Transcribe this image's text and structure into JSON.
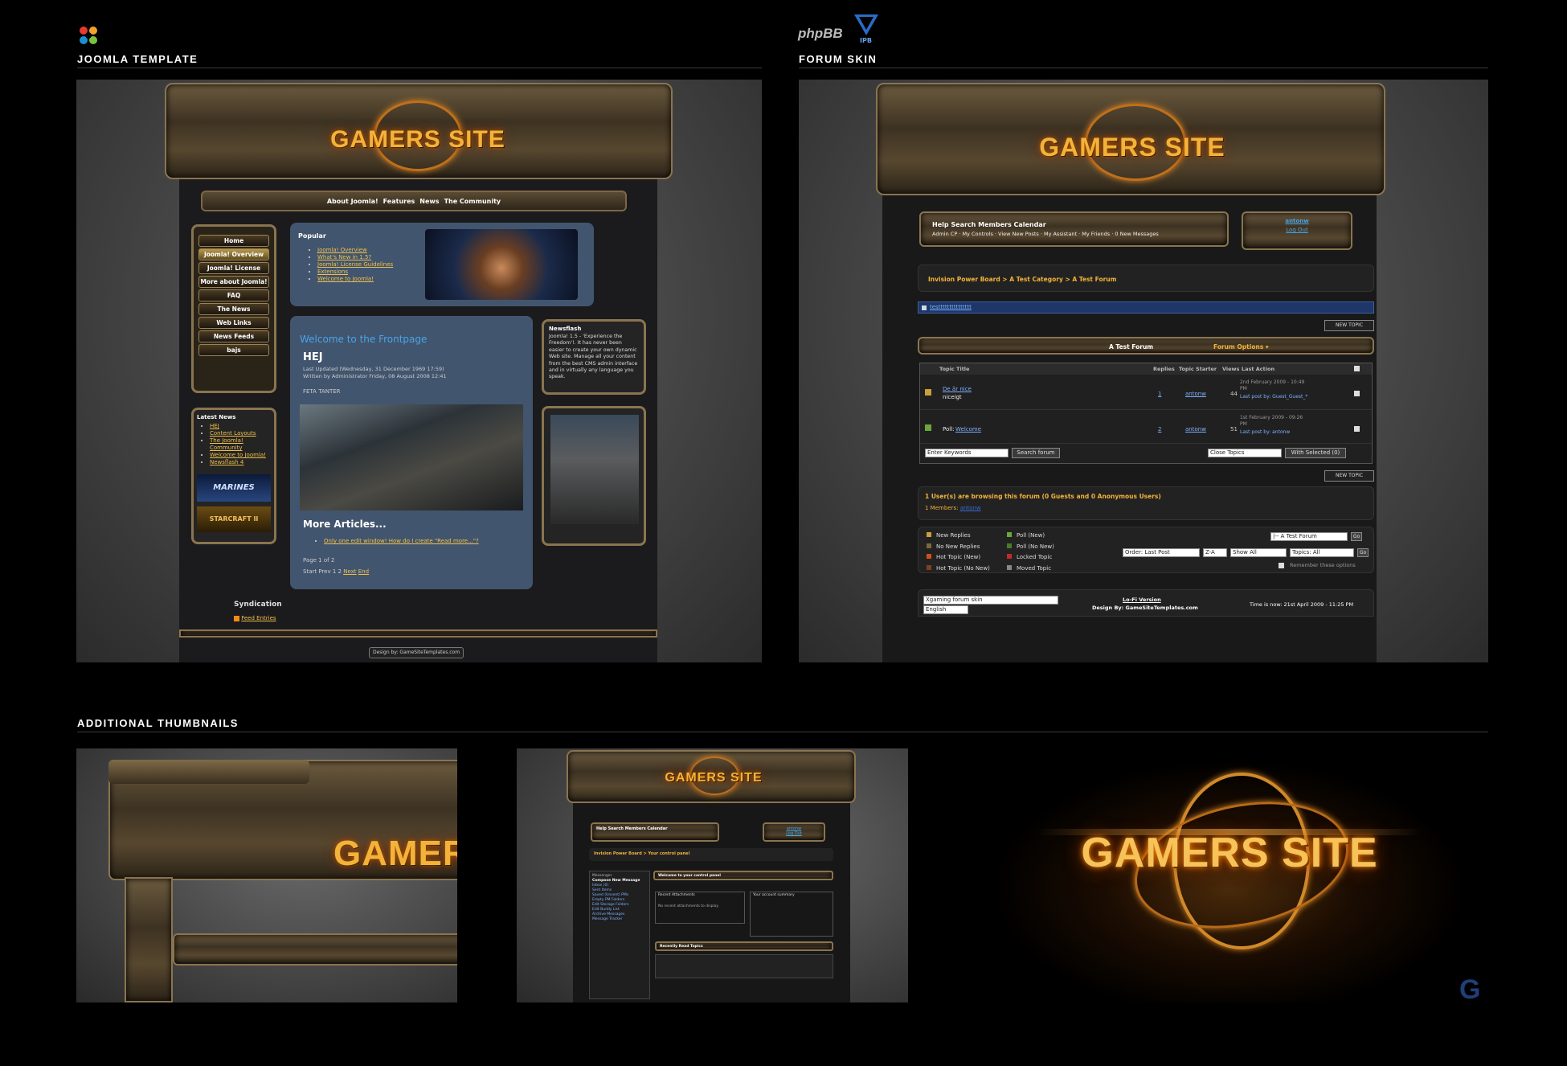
{
  "sections": {
    "joomla": "JOOMLA TEMPLATE",
    "forum": "FORUM SKIN",
    "additional": "ADDITIONAL THUMBNAILS"
  },
  "brand": {
    "logo_text": "GAMERS SITE",
    "phpbb_text": "phpBB",
    "ipb_text": "IPB",
    "accent": "#f3b33a"
  },
  "joomla": {
    "nav": [
      "About Joomla!",
      "Features",
      "News",
      "The Community"
    ],
    "menu": [
      "Home",
      "Joomla! Overview",
      "Joomla! License",
      "More about Joomla!",
      "FAQ",
      "The News",
      "Web Links",
      "News Feeds",
      "bajs"
    ],
    "popular": {
      "title": "Popular",
      "links": [
        "Joomla! Overview",
        "What's New in 1.5?",
        "Joomla! License Guidelines",
        "Extensions",
        "Welcome to Joomla!"
      ]
    },
    "latest_news": {
      "title": "Latest News",
      "links": [
        "HEJ",
        "Content Layouts",
        "The Joomla! Community",
        "Welcome to Joomla!",
        "Newsflash 4"
      ]
    },
    "banners": [
      "MARINES",
      "STARCRAFT II"
    ],
    "frontpage": {
      "heading": "Welcome to the Frontpage",
      "article_title": "HEJ",
      "meta": "Last Updated (Wednesday, 31 December 1969 17:59) Written by Administrator Friday, 08 August 2008 12:41",
      "body": "FETA TANTER",
      "more_heading": "More Articles...",
      "more_link": "Only one edit window! How do I create \"Read more...\"?",
      "page_info": "Page 1 of 2",
      "pager_prefix": "Start Prev 1 2",
      "pager_next": "Next",
      "pager_end": "End"
    },
    "newsflash": {
      "title": "Newsflash",
      "body": "Joomla! 1.5 - 'Experience the Freedom'!. It has never been easier to create your own dynamic Web site. Manage all your content from the best CMS admin interface and in virtually any language you speak."
    },
    "syndication": {
      "title": "Syndication",
      "link": "Feed Entries"
    },
    "footer": "Design by: GameSiteTemplates.com"
  },
  "forum": {
    "top_nav": "Help  Search  Members  Calendar",
    "sub_nav": "Admin CP  ·  My Controls  ·  View New Posts  ·  My Assistant  ·  My Friends  ·  0 New Messages",
    "user": "antonw",
    "logout": "Log Out",
    "breadcrumb": "Invision Power Board > A Test Category > A Test Forum",
    "announcement": "testtttttttttttttt",
    "new_topic": "NEW TOPIC",
    "forum_title": "A Test Forum",
    "forum_options": "Forum Options ▾",
    "columns": [
      "Topic Title",
      "Replies",
      "Topic Starter",
      "Views",
      "Last Action"
    ],
    "topics": [
      {
        "title": "De är nice",
        "desc": "niceigt",
        "replies": "1",
        "starter": "antonw",
        "views": "44",
        "last_date": "2nd February 2009 - 10:49 PM",
        "last_by": "Last post by: Guest_Guest_*"
      },
      {
        "prefix": "Poll:",
        "title": "Welcome",
        "desc": "",
        "replies": "2",
        "starter": "antonw",
        "views": "51",
        "last_date": "1st February 2009 - 09:26 PM",
        "last_by": "Last post by: antonw"
      }
    ],
    "search_placeholder": "Enter Keywords",
    "search_button": "Search forum",
    "close_topics": "Close Topics",
    "with_selected": "With Selected (0)",
    "browsing": "1 User(s) are browsing this forum (0 Guests and 0 Anonymous Users)",
    "members_label": "1 Members:",
    "members_name": "antonw",
    "legend_left": [
      "New Replies",
      "No New Replies",
      "Hot Topic (New)",
      "Hot Topic (No New)"
    ],
    "legend_right": [
      "Poll (New)",
      "Poll (No New)",
      "Locked Topic",
      "Moved Topic"
    ],
    "jump": "|-- A Test Forum",
    "go": "Go",
    "order": "Order: Last Post",
    "za": "Z-A",
    "show": "Show All",
    "topics_all": "Topics: All",
    "remember": "Remember these options",
    "skin_select": "Xgaming forum skin",
    "lang_select": "English",
    "lofi": "Lo-Fi Version",
    "design": "Design By: GameSiteTemplates.com",
    "time": "Time is now: 21st April 2009 - 11:25 PM"
  },
  "thumb2": {
    "top_nav": "Help  Search  Members  Calendar",
    "breadcrumb": "Invision Power Board > Your control panel",
    "welcome": "Welcome to your control panel",
    "left_items": [
      "Messenger",
      "Compose New Message",
      "Inbox (0)",
      "Sent Items",
      "Saved (Unsent) PMs",
      "Empty PM Folders",
      "Edit Storage Folders",
      "Edit Buddy List",
      "Archive Messages",
      "Message Tracker"
    ],
    "recent_attachments": "Recent Attachments",
    "no_attachments": "No recent attachments to display",
    "account_summary": "Your account summary",
    "recent_topics": "Recently Read Topics",
    "user": "antonw",
    "logout": "Log Out"
  },
  "watermark": "G"
}
